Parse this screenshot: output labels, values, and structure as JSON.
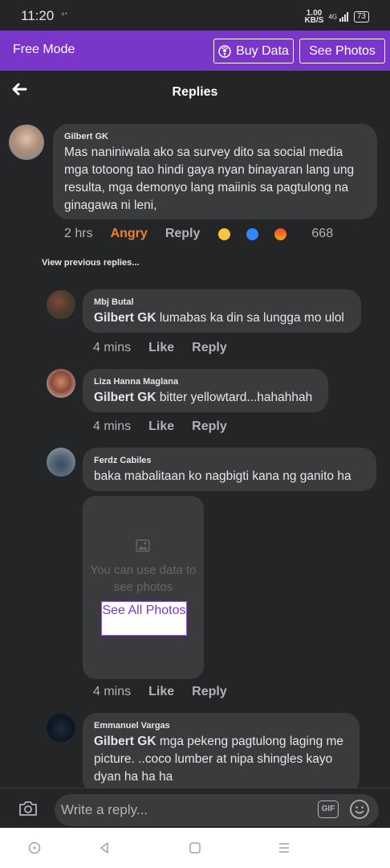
{
  "status_bar": {
    "time": "11:20",
    "net_speed_top": "1.00",
    "net_speed_bottom": "KB/S",
    "signal": "4G",
    "battery": "73"
  },
  "free_bar": {
    "label": "Free Mode",
    "buy_data": "Buy Data",
    "see_photos": "See Photos"
  },
  "header": {
    "title": "Replies"
  },
  "main_comment": {
    "author": "Gilbert GK",
    "text": "Mas naniniwala ako sa survey dito sa social media mga totoong tao hindi gaya nyan binayaran lang ung resulta, mga demonyo lang maiinis sa pagtulong na ginagawa ni leni,",
    "time": "2 hrs",
    "reaction_label": "Angry",
    "reply_label": "Reply",
    "reaction_count": "668"
  },
  "view_previous": "View previous replies...",
  "replies": [
    {
      "author": "Mbj Butal",
      "mention": "Gilbert GK",
      "text": " lumabas ka din sa lungga mo ulol",
      "time": "4 mins",
      "like": "Like",
      "reply": "Reply"
    },
    {
      "author": "Liza Hanna Maglana",
      "mention": "Gilbert GK",
      "text": " bitter yellowtard...hahahhah",
      "time": "4 mins",
      "like": "Like",
      "reply": "Reply"
    },
    {
      "author": "Ferdz Cabiles",
      "mention": "",
      "text": "baka  mabalitaan ko nagbigti kana ng ganito ha",
      "time": "4 mins",
      "like": "Like",
      "reply": "Reply"
    },
    {
      "author": "Emmanuel Vargas",
      "mention": "Gilbert GK",
      "text": " mga pekeng pagtulong laging me picture. ..coco lumber at nipa shingles kayo dyan ha ha ha"
    }
  ],
  "photo_card": {
    "message": "You can use data to see photos",
    "button": "See All Photos"
  },
  "composer": {
    "placeholder": "Write a reply...",
    "gif": "GIF"
  },
  "colors": {
    "accent": "#7a35c9",
    "angry": "#f0802b",
    "bubble": "#3a3b3c",
    "background": "#242526"
  },
  "icons": [
    "back-arrow-icon",
    "data-icon",
    "camera-icon",
    "gif-icon",
    "emoji-icon",
    "image-placeholder-icon",
    "nav-home-icon",
    "nav-back-icon",
    "nav-recents-icon",
    "nav-menu-icon"
  ]
}
